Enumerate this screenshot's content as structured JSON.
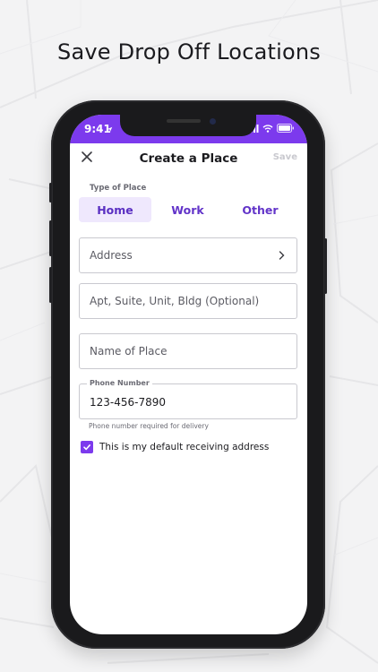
{
  "headline": "Save Drop Off Locations",
  "status_bar": {
    "time": "9:41"
  },
  "nav": {
    "title": "Create a Place",
    "save_label": "Save"
  },
  "type_of_place": {
    "label": "Type of Place",
    "options": [
      "Home",
      "Work",
      "Other"
    ],
    "selected": "Home"
  },
  "form": {
    "address_placeholder": "Address",
    "apt_placeholder": "Apt, Suite, Unit, Bldg (Optional)",
    "name_placeholder": "Name of Place",
    "phone_label": "Phone Number",
    "phone_value": "123-456-7890",
    "phone_helper": "Phone number required for delivery",
    "default_address_label": "This is my default receiving address",
    "default_address_checked": true
  },
  "colors": {
    "accent": "#7c3aed",
    "accent_text": "#6234c9",
    "segment_active_bg": "#efe8fd"
  },
  "icons": {
    "close": "close-icon",
    "chevron": "chevron-right-icon",
    "check": "checkmark-icon",
    "location": "location-arrow-icon",
    "signal": "signal-icon",
    "wifi": "wifi-icon",
    "battery": "battery-icon"
  }
}
